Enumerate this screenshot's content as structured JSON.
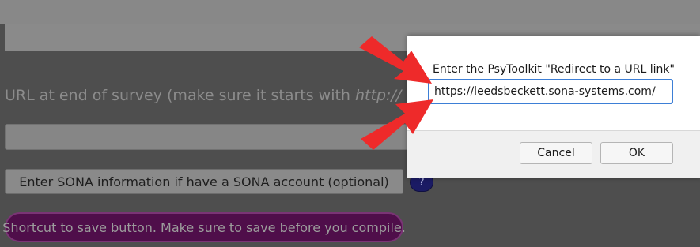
{
  "page": {
    "url_label": "URL at end of survey (make sure it starts with ",
    "url_label_protocol": "http://",
    "sona_button_label": "Enter SONA information if have a SONA account (optional)",
    "help_label": "?",
    "save_shortcut_label": "Shortcut to save button. Make sure to save before you compile."
  },
  "dialog": {
    "prompt": "Enter the PsyToolkit \"Redirect to a URL link\"",
    "input_value": "https://leedsbeckett.sona-systems.com/",
    "cancel_label": "Cancel",
    "ok_label": "OK"
  },
  "colors": {
    "arrow": "#ee2a2a",
    "input_focus": "#3d7fd6",
    "save_button_bg": "#4f0e4a"
  },
  "icons": {
    "arrows": [
      "red-arrow-icon",
      "red-arrow-icon"
    ],
    "help": "question-mark-icon"
  }
}
